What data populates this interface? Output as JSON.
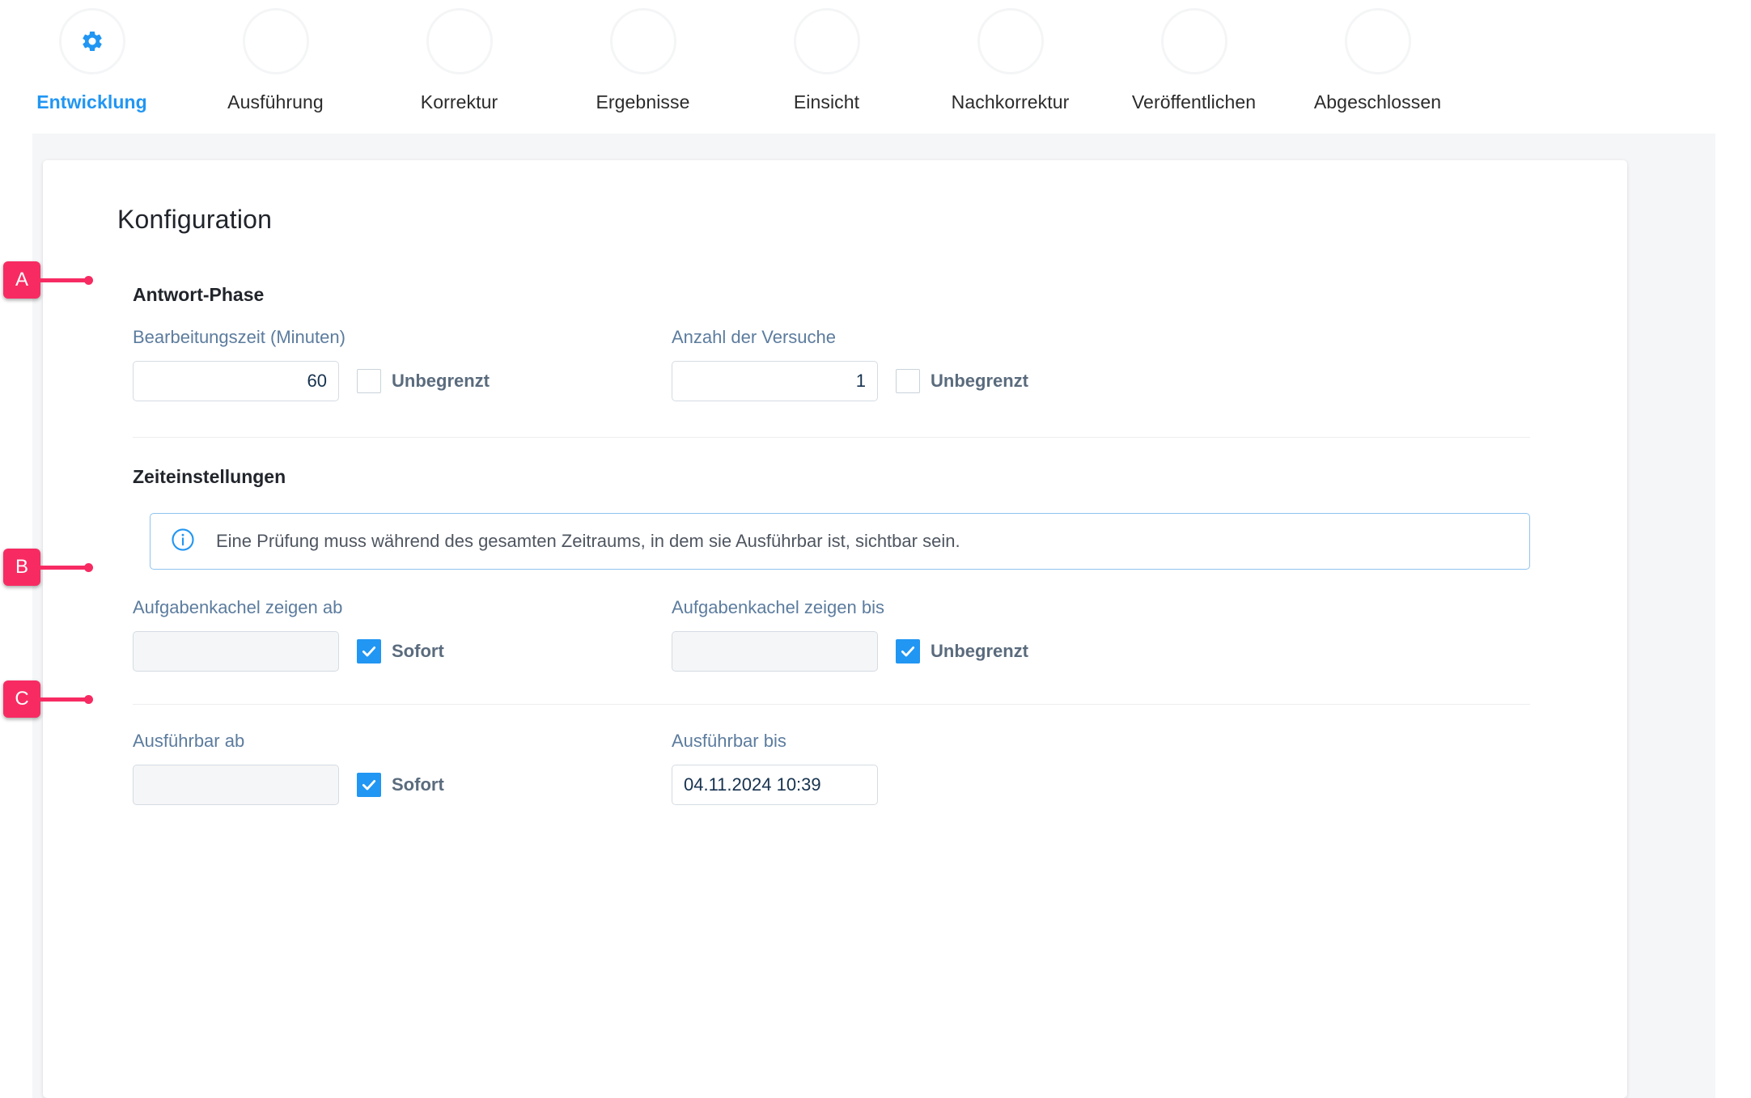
{
  "stepper": {
    "steps": [
      {
        "label": "Entwicklung",
        "icon": "gear-icon",
        "active": true
      },
      {
        "label": "Ausführung",
        "active": false
      },
      {
        "label": "Korrektur",
        "active": false
      },
      {
        "label": "Ergebnisse",
        "active": false
      },
      {
        "label": "Einsicht",
        "active": false
      },
      {
        "label": "Nachkorrektur",
        "active": false
      },
      {
        "label": "Veröffentlichen",
        "active": false
      },
      {
        "label": "Abgeschlossen",
        "active": false
      }
    ],
    "active_color": "#2196f3"
  },
  "card": {
    "title": "Konfiguration",
    "answer_phase": {
      "heading": "Antwort-Phase",
      "processing_time": {
        "label": "Bearbeitungszeit (Minuten)",
        "value": "60",
        "unlimited_label": "Unbegrenzt",
        "unlimited_checked": false
      },
      "attempts": {
        "label": "Anzahl der Versuche",
        "value": "1",
        "unlimited_label": "Unbegrenzt",
        "unlimited_checked": false
      }
    },
    "time_settings": {
      "heading": "Zeiteinstellungen",
      "info": {
        "icon": "info-circle-icon",
        "text": "Eine Prüfung muss während des gesamten Zeitraums, in dem sie Ausführbar ist, sichtbar sein."
      },
      "tile_from": {
        "label": "Aufgabenkachel zeigen ab",
        "value": "",
        "checkbox_label": "Sofort",
        "checked": true
      },
      "tile_until": {
        "label": "Aufgabenkachel zeigen bis",
        "value": "",
        "checkbox_label": "Unbegrenzt",
        "checked": true
      },
      "executable_from": {
        "label": "Ausführbar ab",
        "value": "",
        "checkbox_label": "Sofort",
        "checked": true
      },
      "executable_until": {
        "label": "Ausführbar bis",
        "value": "04.11.2024 10:39"
      }
    }
  },
  "annotations": {
    "color": "#f72b62",
    "items": [
      {
        "id": "A",
        "target": "Antwort-Phase"
      },
      {
        "id": "B",
        "target": "Aufgabenkachel zeigen ab"
      },
      {
        "id": "C",
        "target": "Ausführbar ab"
      }
    ]
  }
}
